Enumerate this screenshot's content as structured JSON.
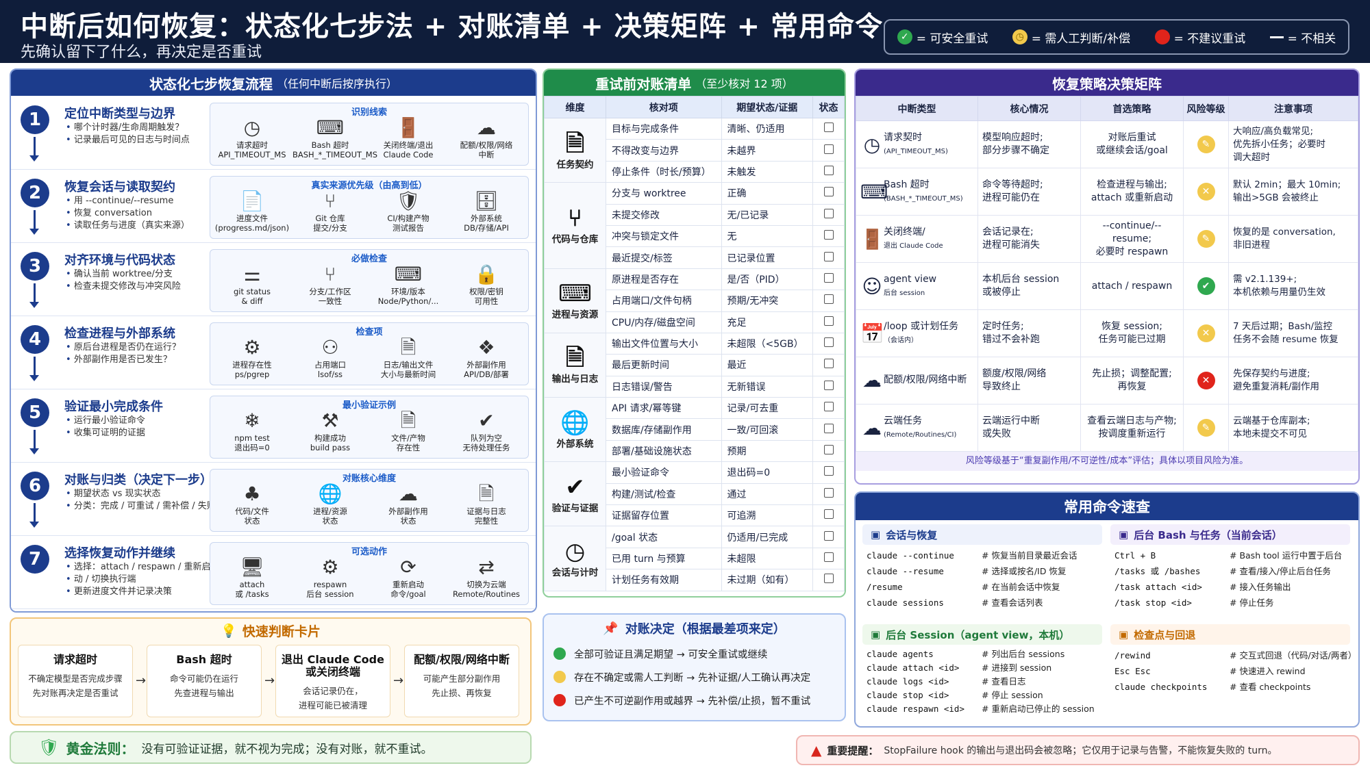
{
  "header": {
    "title": "中断后如何恢复：状态化七步法 + 对账清单 + 决策矩阵 + 常用命令",
    "subtitle": "先确认留下了什么，再决定是否重试"
  },
  "legend": [
    {
      "icon": "check",
      "label": "= 可安全重试"
    },
    {
      "icon": "clock",
      "label": "= 需人工判断/补偿"
    },
    {
      "icon": "red-dot",
      "label": "= 不建议重试"
    },
    {
      "icon": "dash",
      "label": "= 不相关"
    }
  ],
  "steps_panel": {
    "title": "状态化七步恢复流程",
    "title_note": "（任何中断后按序执行）",
    "steps": [
      {
        "num": "1",
        "title": "定位中断类型与边界",
        "bullets": [
          "哪个计时器/生命周期触发？",
          "记录最后可见的日志与时间点"
        ],
        "box_title": "识别线索",
        "items": [
          {
            "icon": "clock",
            "l1": "请求超时",
            "l2": "API_TIMEOUT_MS"
          },
          {
            "icon": "terminal",
            "l1": "Bash 超时",
            "l2": "BASH_*_TIMEOUT_MS"
          },
          {
            "icon": "door",
            "l1": "关闭终端/退出",
            "l2": "Claude Code"
          },
          {
            "icon": "cloud",
            "l1": "配额/权限/网络",
            "l2": "中断"
          }
        ]
      },
      {
        "num": "2",
        "title": "恢复会话与读取契约",
        "bullets": [
          "用 --continue/--resume",
          "恢复 conversation",
          "读取任务与进度（真实来源）"
        ],
        "box_title": "真实来源优先级（由高到低）",
        "items": [
          {
            "icon": "file",
            "l1": "进度文件",
            "l2": "(progress.md/json)"
          },
          {
            "icon": "git",
            "l1": "Git 仓库",
            "l2": "提交/分支"
          },
          {
            "icon": "shield",
            "l1": "CI/构建产物",
            "l2": "测试报告"
          },
          {
            "icon": "db",
            "l1": "外部系统",
            "l2": "DB/存储/API"
          }
        ]
      },
      {
        "num": "3",
        "title": "对齐环境与代码状态",
        "bullets": [
          "确认当前 worktree/分支",
          "检查未提交修改与冲突风险"
        ],
        "box_title": "必做检查",
        "items": [
          {
            "icon": "sliders",
            "l1": "git status",
            "l2": "& diff"
          },
          {
            "icon": "branch",
            "l1": "分支/工作区",
            "l2": "一致性"
          },
          {
            "icon": "terminal",
            "l1": "环境/版本",
            "l2": "Node/Python/..."
          },
          {
            "icon": "lock",
            "l1": "权限/密钥",
            "l2": "可用性"
          }
        ]
      },
      {
        "num": "4",
        "title": "检查进程与外部系统",
        "bullets": [
          "原后台进程是否仍在运行？",
          "外部副作用是否已发生？"
        ],
        "box_title": "检查项",
        "items": [
          {
            "icon": "process",
            "l1": "进程存在性",
            "l2": "ps/pgrep"
          },
          {
            "icon": "port",
            "l1": "占用端口",
            "l2": "lsof/ss"
          },
          {
            "icon": "log",
            "l1": "日志/输出文件",
            "l2": "大小与最新时间"
          },
          {
            "icon": "cubes",
            "l1": "外部副作用",
            "l2": "API/DB/部署"
          }
        ]
      },
      {
        "num": "5",
        "title": "验证最小完成条件",
        "bullets": [
          "运行最小验证命令",
          "收集可证明的证据"
        ],
        "box_title": "最小验证示例",
        "items": [
          {
            "icon": "snow",
            "l1": "npm test",
            "l2": "退出码=0"
          },
          {
            "icon": "build",
            "l1": "构建成功",
            "l2": "build pass"
          },
          {
            "icon": "doc",
            "l1": "文件/产物",
            "l2": "存在性"
          },
          {
            "icon": "check",
            "l1": "队列为空",
            "l2": "无待处理任务"
          }
        ]
      },
      {
        "num": "6",
        "title": "对账与归类（决定下一步）",
        "bullets": [
          "期望状态 vs 现实状态",
          "分类：完成 / 可重试 / 需补偿 / 失败"
        ],
        "box_title": "对账核心维度",
        "items": [
          {
            "icon": "tree",
            "l1": "代码/文件",
            "l2": "状态"
          },
          {
            "icon": "globe",
            "l1": "进程/资源",
            "l2": "状态"
          },
          {
            "icon": "cloud",
            "l1": "外部副作用",
            "l2": "状态"
          },
          {
            "icon": "doc",
            "l1": "证据与日志",
            "l2": "完整性"
          }
        ]
      },
      {
        "num": "7",
        "title": "选择恢复动作并继续",
        "bullets": [
          "选择：attach / respawn / 重新启",
          "动 / 切换执行端",
          "更新进度文件并记录决策"
        ],
        "box_title": "可选动作",
        "items": [
          {
            "icon": "monitor",
            "l1": "attach",
            "l2": "或 /tasks"
          },
          {
            "icon": "gear",
            "l1": "respawn",
            "l2": "后台 session"
          },
          {
            "icon": "restart",
            "l1": "重新启动",
            "l2": "命令/goal"
          },
          {
            "icon": "switch",
            "l1": "切换为云端",
            "l2": "Remote/Routines"
          }
        ]
      }
    ]
  },
  "quick_cards": {
    "title": "快速判断卡片",
    "cards": [
      {
        "title": "请求超时",
        "desc": [
          "不确定模型是否完成步骤",
          "先对账再决定是否重试"
        ]
      },
      {
        "title": "Bash 超时",
        "desc": [
          "命令可能仍在运行",
          "先查进程与输出"
        ]
      },
      {
        "title": "退出 Claude Code 或关闭终端",
        "desc": [
          "会话记录仍在，",
          "进程可能已被清理"
        ]
      },
      {
        "title": "配额/权限/网络中断",
        "desc": [
          "可能产生部分副作用",
          "先止损、再恢复"
        ]
      }
    ]
  },
  "golden_rule": {
    "label": "黄金法则：",
    "text": "没有可验证证据，就不视为完成；没有对账，就不重试。"
  },
  "checklist": {
    "title": "重试前对账清单",
    "title_note": "（至少核对 12 项）",
    "headers": [
      "维度",
      "核对项",
      "期望状态/证据",
      "状态"
    ],
    "groups": [
      {
        "name": "任务契约",
        "icon": "doc",
        "rows": [
          [
            "目标与完成条件",
            "清晰、仍适用"
          ],
          [
            "不得改变与边界",
            "未越界"
          ],
          [
            "停止条件（时长/预算）",
            "未触发"
          ]
        ]
      },
      {
        "name": "代码与仓库",
        "icon": "branch",
        "rows": [
          [
            "分支与 worktree",
            "正确"
          ],
          [
            "未提交修改",
            "无/已记录"
          ],
          [
            "冲突与锁定文件",
            "无"
          ],
          [
            "最近提交/标签",
            "已记录位置"
          ]
        ]
      },
      {
        "name": "进程与资源",
        "icon": "terminal",
        "rows": [
          [
            "原进程是否存在",
            "是/否（PID）"
          ],
          [
            "占用端口/文件句柄",
            "预期/无冲突"
          ],
          [
            "CPU/内存/磁盘空间",
            "充足"
          ]
        ]
      },
      {
        "name": "输出与日志",
        "icon": "doc",
        "rows": [
          [
            "输出文件位置与大小",
            "未超限（<5GB）"
          ],
          [
            "最后更新时间",
            "最近"
          ],
          [
            "日志错误/警告",
            "无新错误"
          ]
        ]
      },
      {
        "name": "外部系统",
        "icon": "globe",
        "rows": [
          [
            "API 请求/幂等键",
            "记录/可去重"
          ],
          [
            "数据库/存储副作用",
            "一致/可回滚"
          ],
          [
            "部署/基础设施状态",
            "预期"
          ]
        ]
      },
      {
        "name": "验证与证据",
        "icon": "check",
        "rows": [
          [
            "最小验证命令",
            "退出码=0"
          ],
          [
            "构建/测试/检查",
            "通过"
          ],
          [
            "证据留存位置",
            "可追溯"
          ]
        ]
      },
      {
        "name": "会话与计时",
        "icon": "clock",
        "rows": [
          [
            "/goal 状态",
            "仍适用/已完成"
          ],
          [
            "已用 turn 与预算",
            "未超限"
          ],
          [
            "计划任务有效期",
            "未过期（如有）"
          ]
        ]
      }
    ]
  },
  "reconcile": {
    "title": "对账决定（根据最差项来定）",
    "rows": [
      {
        "color": "#2fa84f",
        "text": "全部可验证且满足期望 → 可安全重试或继续"
      },
      {
        "color": "#f2c94c",
        "text": "存在不确定或需人工判断 → 先补证据/人工确认再决定"
      },
      {
        "color": "#e0241b",
        "text": "已产生不可逆副作用或越界 → 先补偿/止损，暂不重试"
      }
    ]
  },
  "matrix": {
    "title": "恢复策略决策矩阵",
    "headers": [
      "中断类型",
      "核心情况",
      "首选策略",
      "风险等级",
      "注意事项"
    ],
    "rows": [
      {
        "icon": "clock",
        "type": "请求契时",
        "sub": "(API_TIMEOUT_MS)",
        "core": [
          "模型响应超时;",
          "部分步骤不确定"
        ],
        "strategy": [
          "对账后重试",
          "或继续会话/goal"
        ],
        "risk": "yellow",
        "note": [
          "大响应/高负载常见;",
          "优先拆小任务；必要时",
          "调大超时"
        ]
      },
      {
        "icon": "terminal",
        "type": "Bash 超时",
        "sub": "(BASH_*_TIMEOUT_MS)",
        "core": [
          "命令等待超时;",
          "进程可能仍在"
        ],
        "strategy": [
          "检查进程与输出;",
          "attach 或重新启动"
        ],
        "risk": "yellow-x",
        "note": [
          "默认 2min；最大 10min;",
          "输出>5GB 会被终止"
        ]
      },
      {
        "icon": "door",
        "type": "关闭终端/",
        "sub": "退出 Claude Code",
        "core": [
          "会话记录在;",
          "进程可能消失"
        ],
        "strategy": [
          "--continue/--resume;",
          "必要时 respawn"
        ],
        "risk": "yellow",
        "note": [
          "恢复的是 conversation,",
          "非旧进程"
        ]
      },
      {
        "icon": "face",
        "type": "agent view",
        "sub": "后台 session",
        "core": [
          "本机后台 session",
          "或被停止"
        ],
        "strategy": [
          "attach / respawn"
        ],
        "risk": "green",
        "note": [
          "需 v2.1.139+;",
          "本机依赖与用量仍生效"
        ]
      },
      {
        "icon": "calendar",
        "type": "/loop 或计划任务",
        "sub": "（会话内）",
        "core": [
          "定时任务;",
          "错过不会补跑"
        ],
        "strategy": [
          "恢复 session;",
          "任务可能已过期"
        ],
        "risk": "yellow-x",
        "note": [
          "7 天后过期；Bash/监控",
          "任务不会随 resume 恢复"
        ]
      },
      {
        "icon": "cloud",
        "type": "配额/权限/网络中断",
        "sub": "",
        "core": [
          "额度/权限/网络",
          "导致终止"
        ],
        "strategy": [
          "先止损；调整配置;",
          "再恢复"
        ],
        "risk": "red",
        "note": [
          "先保存契约与进度;",
          "避免重复消耗/副作用"
        ]
      },
      {
        "icon": "cloud",
        "type": "云端任务",
        "sub": "(Remote/Routines/CI)",
        "core": [
          "云端运行中断",
          "或失败"
        ],
        "strategy": [
          "查看云端日志与产物;",
          "按调度重新运行"
        ],
        "risk": "yellow",
        "note": [
          "云端基于仓库副本;",
          "本地未提交不可见"
        ]
      }
    ],
    "footnote": "风险等级基于“重复副作用/不可逆性/成本”评估；具体以项目风险为准。"
  },
  "commands": {
    "title": "常用命令速查",
    "sections": [
      {
        "title": "会话与恢复",
        "rows": [
          [
            "claude --continue",
            "# 恢复当前目录最近会话"
          ],
          [
            "claude --resume",
            "# 选择或按名/ID 恢复"
          ],
          [
            "/resume",
            "# 在当前会话中恢复"
          ],
          [
            "claude sessions",
            "# 查看会话列表"
          ]
        ]
      },
      {
        "title": "后台 Bash 与任务（当前会话）",
        "rows": [
          [
            "Ctrl + B",
            "# Bash tool 运行中置于后台"
          ],
          [
            "/tasks 或 /bashes",
            "# 查看/接入/停止后台任务"
          ],
          [
            "/task attach <id>",
            "# 接入任务输出"
          ],
          [
            "/task stop <id>",
            "# 停止任务"
          ]
        ]
      },
      {
        "title": "后台 Session（agent view，本机）",
        "rows": [
          [
            "claude agents",
            "# 列出后台 sessions"
          ],
          [
            "claude attach <id>",
            "# 进接到 session"
          ],
          [
            "claude logs <id>",
            "# 查看日志"
          ],
          [
            "claude stop <id>",
            "# 停止 session"
          ],
          [
            "claude respawn <id>",
            "# 重新启动已停止的 session"
          ]
        ]
      },
      {
        "title": "检查点与回退",
        "rows": [
          [
            "/rewind",
            "# 交互式回退（代码/对话/两者）"
          ],
          [
            "Esc Esc",
            "# 快速进入 rewind"
          ],
          [
            "claude checkpoints",
            "# 查看 checkpoints"
          ]
        ]
      }
    ]
  },
  "warning": {
    "label": "重要提醒：",
    "text": "StopFailure hook 的输出与退出码会被忽略；它仅用于记录与告警，不能恢复失败的 turn。"
  }
}
